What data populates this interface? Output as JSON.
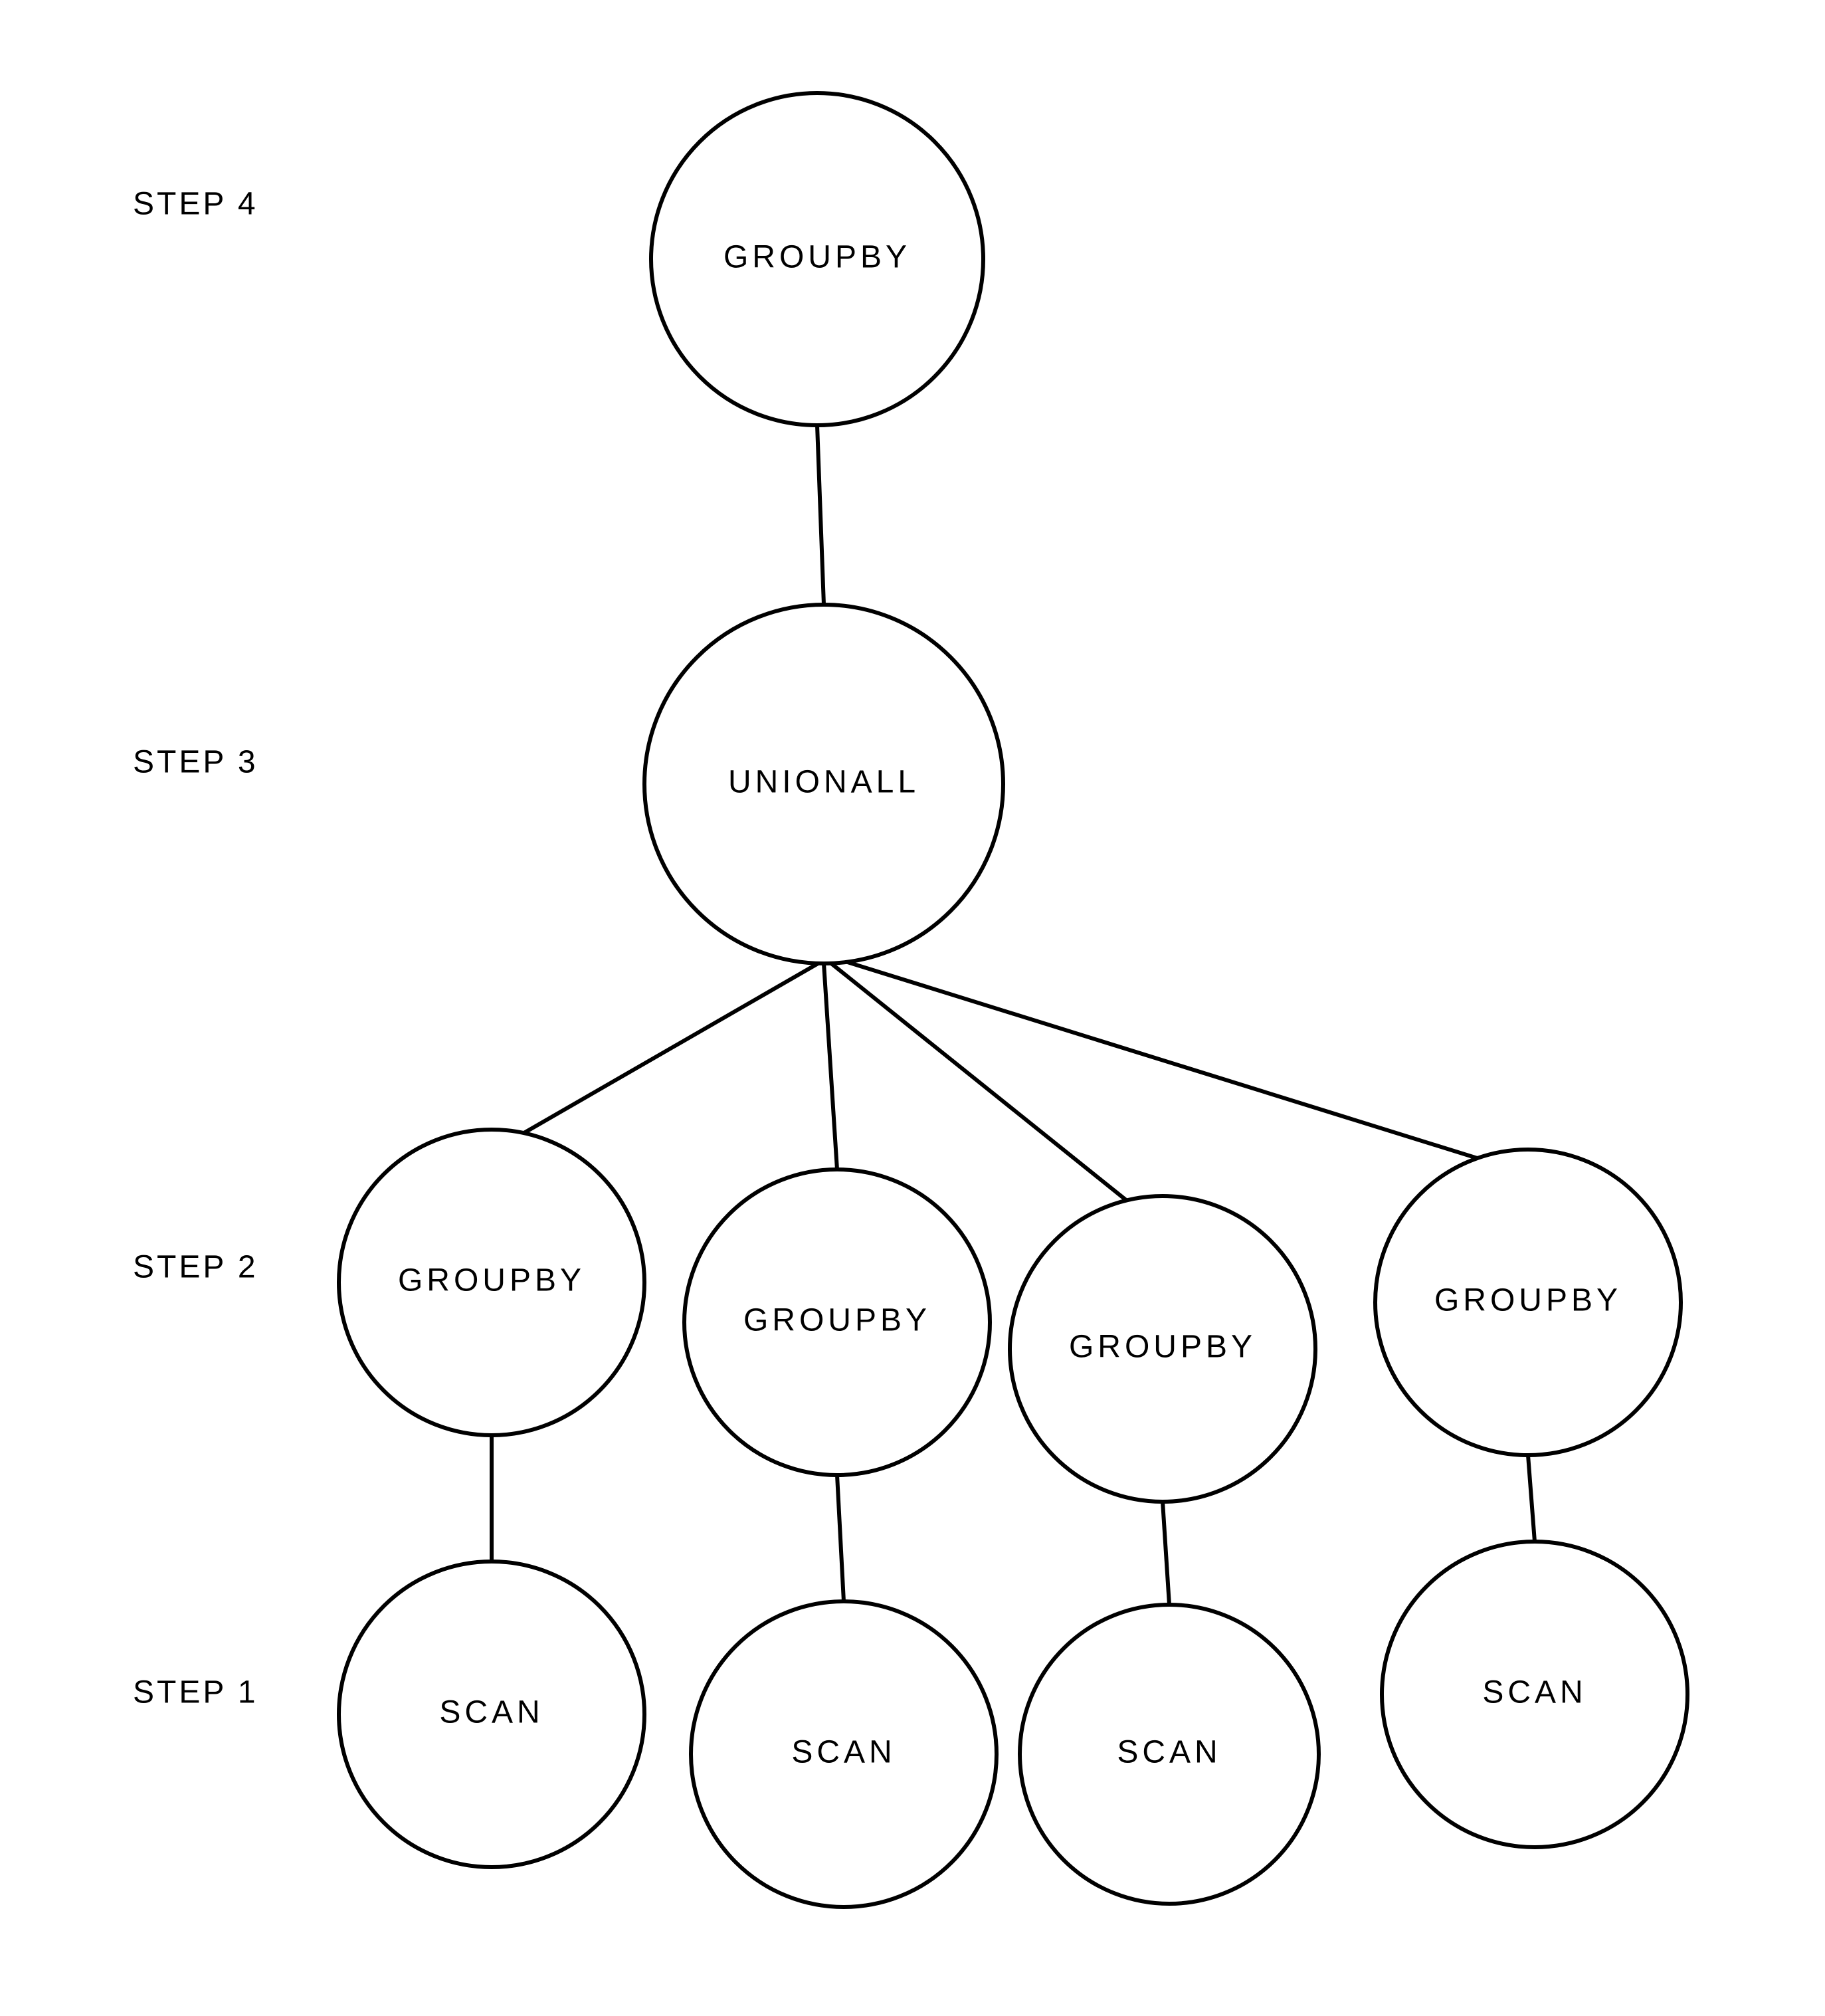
{
  "steps": {
    "step4": "STEP 4",
    "step3": "STEP 3",
    "step2": "STEP 2",
    "step1": "STEP 1"
  },
  "nodes": {
    "root_groupby": "GROUPBY",
    "unionall": "UNIONALL",
    "groupby1": "GROUPBY",
    "groupby2": "GROUPBY",
    "groupby3": "GROUPBY",
    "groupby4": "GROUPBY",
    "scan1": "SCAN",
    "scan2": "SCAN",
    "scan3": "SCAN",
    "scan4": "SCAN"
  },
  "diagram": {
    "type": "tree",
    "edges": [
      [
        "root_groupby",
        "unionall"
      ],
      [
        "unionall",
        "groupby1"
      ],
      [
        "unionall",
        "groupby2"
      ],
      [
        "unionall",
        "groupby3"
      ],
      [
        "unionall",
        "groupby4"
      ],
      [
        "groupby1",
        "scan1"
      ],
      [
        "groupby2",
        "scan2"
      ],
      [
        "groupby3",
        "scan3"
      ],
      [
        "groupby4",
        "scan4"
      ]
    ],
    "levels": {
      "step4": [
        "root_groupby"
      ],
      "step3": [
        "unionall"
      ],
      "step2": [
        "groupby1",
        "groupby2",
        "groupby3",
        "groupby4"
      ],
      "step1": [
        "scan1",
        "scan2",
        "scan3",
        "scan4"
      ]
    }
  }
}
